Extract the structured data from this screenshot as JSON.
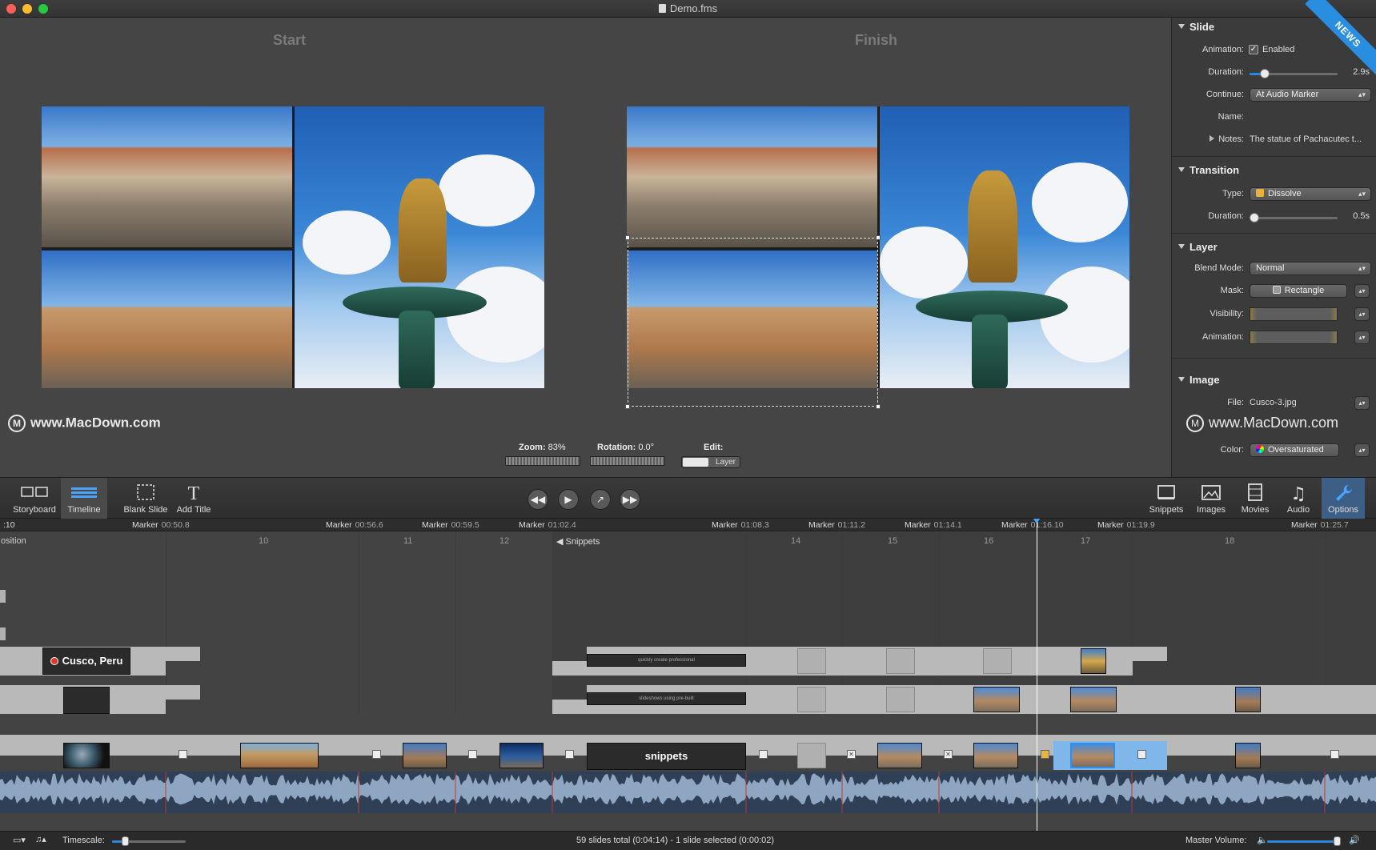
{
  "window": {
    "title": "Demo.fms",
    "ribbon": "NEWS"
  },
  "preview": {
    "start_label": "Start",
    "finish_label": "Finish",
    "watermark": "www.MacDown.com",
    "zoom_label": "Zoom:",
    "zoom_value": "83%",
    "rotation_label": "Rotation:",
    "rotation_value": "0.0°",
    "edit_label": "Edit:",
    "edit_value": "Layer"
  },
  "inspector": {
    "slide": {
      "header": "Slide",
      "animation_label": "Animation:",
      "animation_value": "Enabled",
      "animation_checked": true,
      "duration_label": "Duration:",
      "duration_value": "2.9s",
      "duration_level": 0.17,
      "continue_label": "Continue:",
      "continue_value": "At Audio Marker",
      "name_label": "Name:",
      "name_value": "",
      "notes_label": "Notes:",
      "notes_value": "The statue of Pachacutec t..."
    },
    "transition": {
      "header": "Transition",
      "type_label": "Type:",
      "type_value": "Dissolve",
      "duration_label": "Duration:",
      "duration_value": "0.5s",
      "duration_level": 0.05
    },
    "layer": {
      "header": "Layer",
      "blend_label": "Blend Mode:",
      "blend_value": "Normal",
      "mask_label": "Mask:",
      "mask_value": "Rectangle",
      "visibility_label": "Visibility:",
      "animation_label": "Animation:"
    },
    "image": {
      "header": "Image",
      "file_label": "File:",
      "file_value": "Cusco-3.jpg",
      "color_label": "Color:",
      "color_value": "Oversaturated"
    },
    "watermark": "www.MacDown.com"
  },
  "toolbar": {
    "storyboard": "Storyboard",
    "timeline": "Timeline",
    "blank_slide": "Blank Slide",
    "add_title": "Add Title",
    "snippets": "Snippets",
    "images": "Images",
    "movies": "Movies",
    "audio": "Audio",
    "options": "Options"
  },
  "timeline": {
    "markers": [
      {
        "label": ":10",
        "time": ""
      },
      {
        "label": "Marker",
        "time": "00:50.8"
      },
      {
        "label": "Marker",
        "time": "00:56.6"
      },
      {
        "label": "Marker",
        "time": "00:59.5"
      },
      {
        "label": "Marker",
        "time": "01:02.4"
      },
      {
        "label": "Marker",
        "time": "01:08.3"
      },
      {
        "label": "Marker",
        "time": "01:11.2"
      },
      {
        "label": "Marker",
        "time": "01:14.1"
      },
      {
        "label": "Marker",
        "time": "01:16.10"
      },
      {
        "label": "Marker",
        "time": "01:19.9"
      },
      {
        "label": "Marker",
        "time": "01:25.7"
      }
    ],
    "segment_labels": [
      "osition",
      "10",
      "11",
      "12",
      "Snippets",
      "14",
      "15",
      "16",
      "17",
      "18"
    ],
    "title_slide": "Cusco, Peru",
    "snippets_slide": "snippets",
    "mini_text_1": "quickly create professional",
    "mini_text_2": "slideshows using pre-built"
  },
  "statusbar": {
    "timescale_label": "Timescale:",
    "summary": "59 slides total (0:04:14)  -  1 slide selected (0:00:02)",
    "master_volume_label": "Master Volume:"
  }
}
